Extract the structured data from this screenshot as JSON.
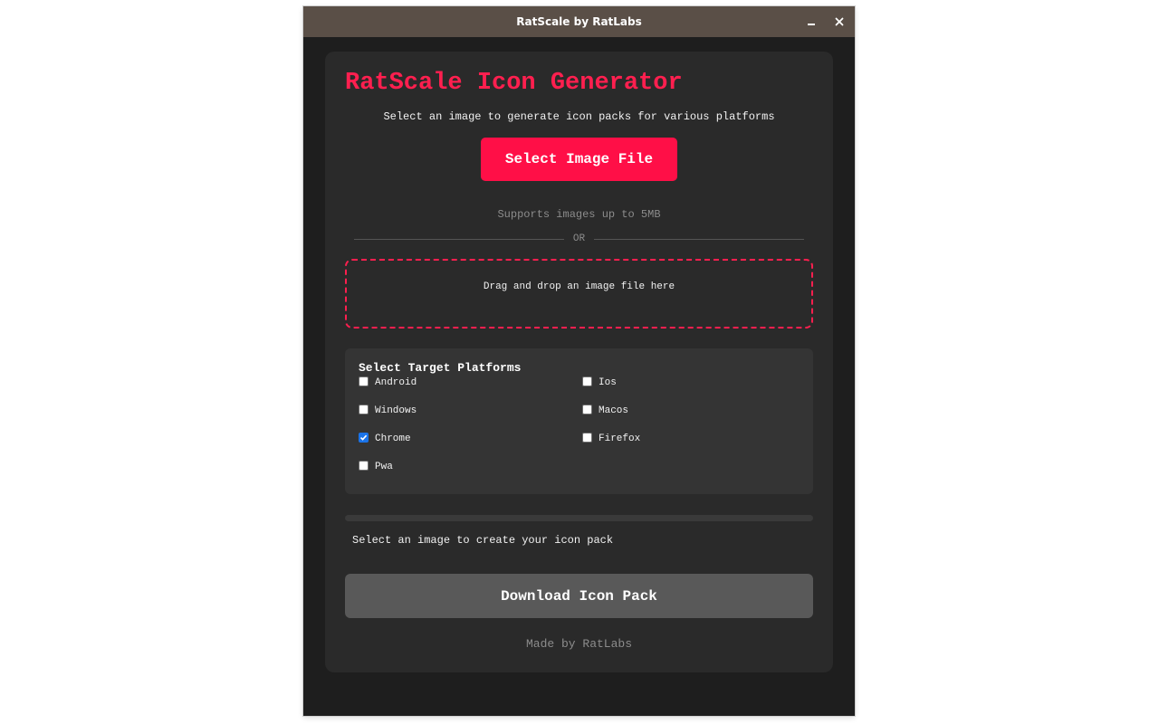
{
  "window": {
    "title": "RatScale by RatLabs"
  },
  "app": {
    "title": "RatScale Icon Generator",
    "subtitle": "Select an image to generate icon packs for various platforms",
    "select_button": "Select Image File",
    "supports_note": "Supports images up to 5MB",
    "or_label": "OR",
    "dropzone_text": "Drag and drop an image file here"
  },
  "platforms": {
    "title": "Select Target Platforms",
    "options": [
      {
        "label": "Android",
        "checked": false
      },
      {
        "label": "Ios",
        "checked": false
      },
      {
        "label": "Windows",
        "checked": false
      },
      {
        "label": "Macos",
        "checked": false
      },
      {
        "label": "Chrome",
        "checked": true
      },
      {
        "label": "Firefox",
        "checked": false
      },
      {
        "label": "Pwa",
        "checked": false
      }
    ]
  },
  "progress": {
    "percent": 0,
    "status": "Select an image to create your icon pack"
  },
  "download_button": "Download Icon Pack",
  "footer": "Made by RatLabs",
  "colors": {
    "accent": "#ff1f4f",
    "titlebar": "#5a4f47",
    "card": "#2a2a2a",
    "disabled_button": "#595959"
  },
  "icons": {
    "minimize": "minimize-icon",
    "close": "close-icon",
    "checkmark": "checkmark-icon"
  }
}
